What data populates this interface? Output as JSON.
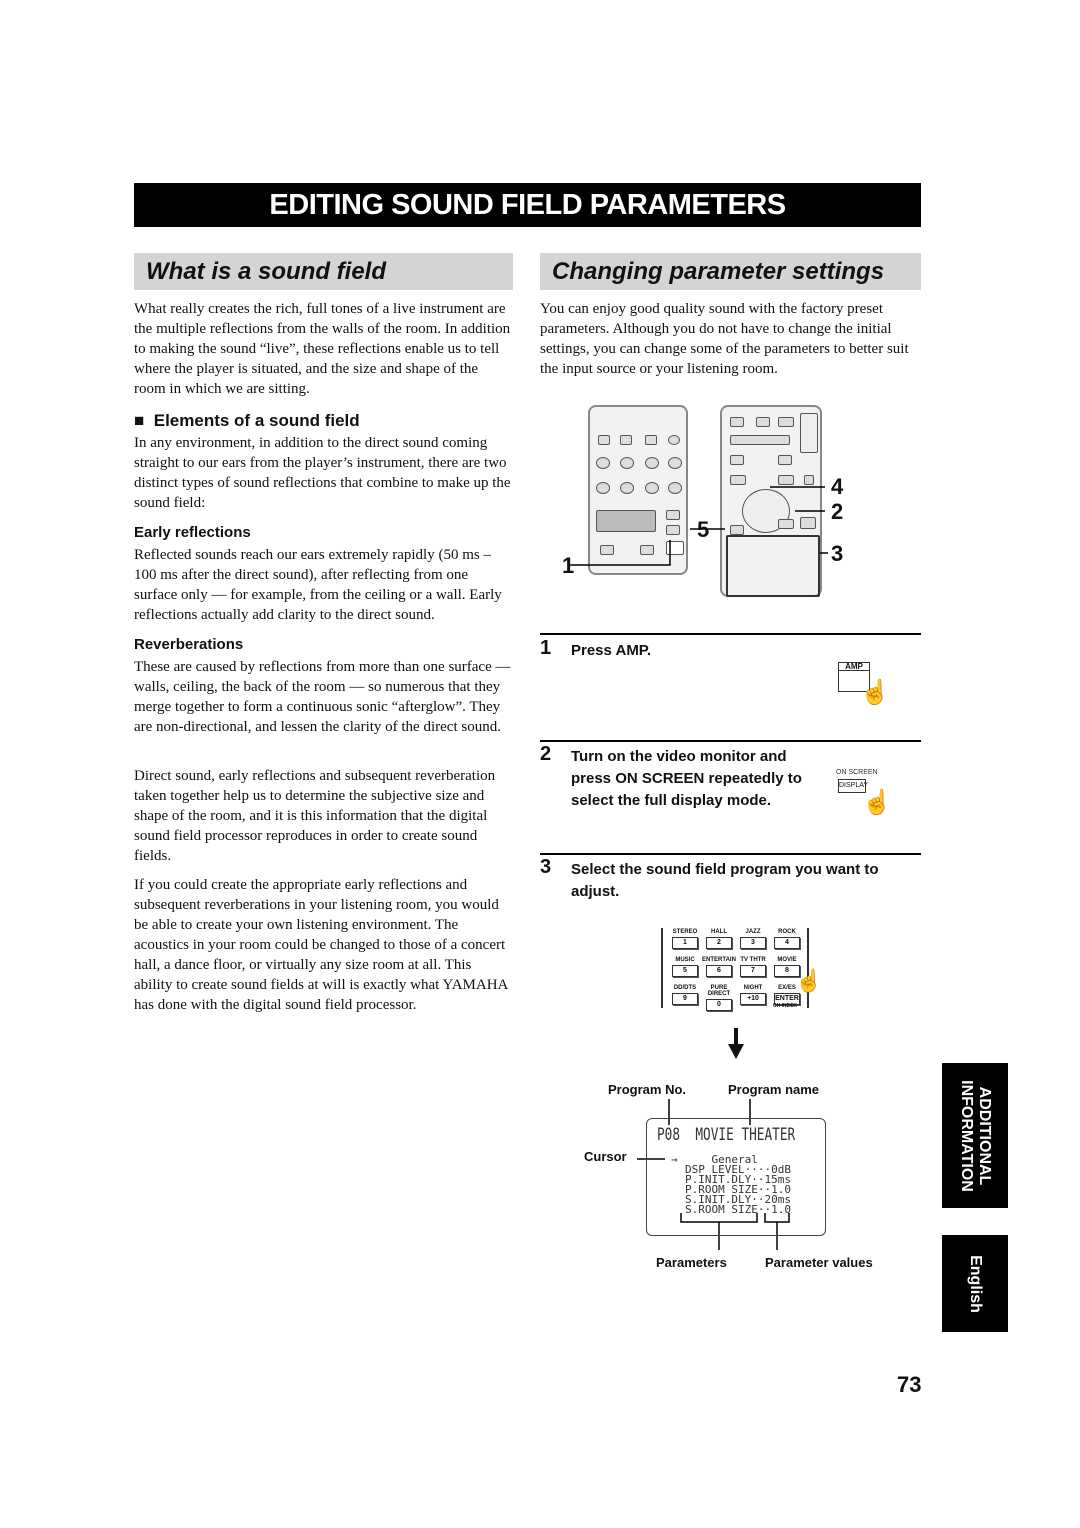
{
  "title": "EDITING SOUND FIELD PARAMETERS",
  "left": {
    "heading": "What is a sound field",
    "intro": "What really creates the rich, full tones of a live instrument are the multiple reflections from the walls of the room. In addition to making the sound “live”, these reflections enable us to tell where the player is situated, and the size and shape of the room in which we are sitting.",
    "subheading": "Elements of a sound field",
    "elements_text": "In any environment, in addition to the direct sound coming straight to our ears from the player’s instrument, there are two distinct types of sound reflections that combine to make up the sound field:",
    "early_heading": "Early reflections",
    "early_text": "Reflected sounds reach our ears extremely rapidly (50 ms – 100 ms after the direct sound), after reflecting from one surface only — for example, from the ceiling or a wall. Early reflections actually add clarity to the direct sound.",
    "reverb_heading": "Reverberations",
    "reverb_text": "These are caused by reflections from more than one surface — walls, ceiling, the back of the room — so numerous that they merge together to form a continuous sonic “afterglow”. They are non-directional, and lessen the clarity of the direct sound.",
    "para2": "Direct sound, early reflections and subsequent reverberation taken together help us to determine the subjective size and shape of the room, and it is this information that the digital sound field processor reproduces in order to create sound fields.",
    "para3": "If you could create the appropriate early reflections and subsequent reverberations in your listening room, you would be able to create your own listening environment. The acoustics in your room could be changed to those of a concert hall, a dance floor, or virtually any size room at all. This ability to create sound fields at will is exactly what YAMAHA has done with the digital sound field processor."
  },
  "right": {
    "heading": "Changing parameter settings",
    "intro": "You can enjoy good quality sound with the factory preset parameters. Although you do not have to change the initial settings, you can change some of the parameters to better suit the input source or your listening room.",
    "callouts": [
      "1",
      "5",
      "4",
      "2",
      "3"
    ],
    "steps": [
      {
        "num": "1",
        "text": "Press AMP.",
        "button": "AMP"
      },
      {
        "num": "2",
        "text": "Turn on the video monitor and press ON SCREEN repeatedly to select the full display mode.",
        "button_top": "ON SCREEN",
        "button": "DISPLAY"
      },
      {
        "num": "3",
        "text": "Select the sound field program you want to adjust."
      }
    ],
    "keypad": [
      {
        "label": "STEREO",
        "key": "1"
      },
      {
        "label": "HALL",
        "key": "2"
      },
      {
        "label": "JAZZ",
        "key": "3"
      },
      {
        "label": "ROCK",
        "key": "4"
      },
      {
        "label": "MUSIC",
        "key": "5"
      },
      {
        "label": "ENTERTAIN",
        "key": "6"
      },
      {
        "label": "TV THTR",
        "key": "7"
      },
      {
        "label": "MOVIE",
        "key": "8"
      },
      {
        "label": "DD/DTS",
        "key": "9"
      },
      {
        "label": "PURE DIRECT",
        "key": "0"
      },
      {
        "label": "NIGHT",
        "key": "+10"
      },
      {
        "label": "EX/ES",
        "key": "ENTER"
      }
    ],
    "keypad_sub": "CH INDEX",
    "display": {
      "program_no_label": "Program No.",
      "program_name_label": "Program name",
      "cursor_label": "Cursor",
      "parameters_label": "Parameters",
      "values_label": "Parameter values",
      "header": "P08  MOVIE THEATER",
      "cursor": "→",
      "lines": [
        "    General",
        "DSP LEVEL····0dB",
        "P.INIT.DLY··15ms",
        "P.ROOM SIZE··1.0",
        "S.INIT.DLY··20ms",
        "S.ROOM SIZE··1.0"
      ]
    }
  },
  "side_tabs": {
    "section": "ADDITIONAL INFORMATION",
    "language": "English"
  },
  "page_number": "73"
}
